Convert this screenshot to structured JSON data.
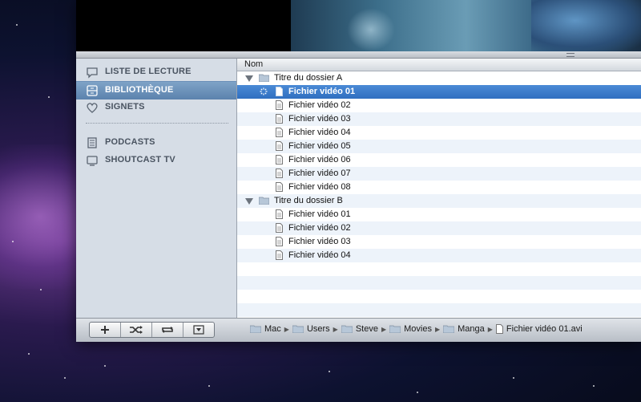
{
  "sidebar": {
    "items": [
      {
        "label": "LISTE DE LECTURE",
        "icon": "speech-bubble-icon"
      },
      {
        "label": "BIBLIOTHÈQUE",
        "icon": "drawer-icon"
      },
      {
        "label": "SIGNETS",
        "icon": "heart-icon"
      },
      {
        "label": "PODCASTS",
        "icon": "document-icon"
      },
      {
        "label": "SHOUTCAST TV",
        "icon": "tv-icon"
      }
    ],
    "selected": "BIBLIOTHÈQUE"
  },
  "list": {
    "column_header": "Nom",
    "rows": [
      {
        "type": "folder",
        "label": "Titre du dossier A"
      },
      {
        "type": "file",
        "label": "Fichier vidéo 01",
        "selected": true
      },
      {
        "type": "file",
        "label": "Fichier vidéo 02"
      },
      {
        "type": "file",
        "label": "Fichier vidéo 03"
      },
      {
        "type": "file",
        "label": "Fichier vidéo 04"
      },
      {
        "type": "file",
        "label": "Fichier vidéo 05"
      },
      {
        "type": "file",
        "label": "Fichier vidéo 06"
      },
      {
        "type": "file",
        "label": "Fichier vidéo 07"
      },
      {
        "type": "file",
        "label": "Fichier vidéo 08"
      },
      {
        "type": "folder",
        "label": "Titre du dossier B"
      },
      {
        "type": "file",
        "label": "Fichier vidéo 01"
      },
      {
        "type": "file",
        "label": "Fichier vidéo 02"
      },
      {
        "type": "file",
        "label": "Fichier vidéo 03"
      },
      {
        "type": "file",
        "label": "Fichier vidéo 04"
      }
    ]
  },
  "toolbar": {
    "buttons": [
      "add-icon",
      "shuffle-icon",
      "repeat-icon",
      "menu-dropdown-icon"
    ]
  },
  "path_bar": {
    "crumbs": [
      "Mac",
      "Users",
      "Steve",
      "Movies",
      "Manga",
      "Fichier vidéo 01.avi"
    ]
  },
  "colors": {
    "selection": "#2f6fc0",
    "sidebar_bg": "#d6dde6",
    "sidebar_selected": "#5b82ad"
  }
}
